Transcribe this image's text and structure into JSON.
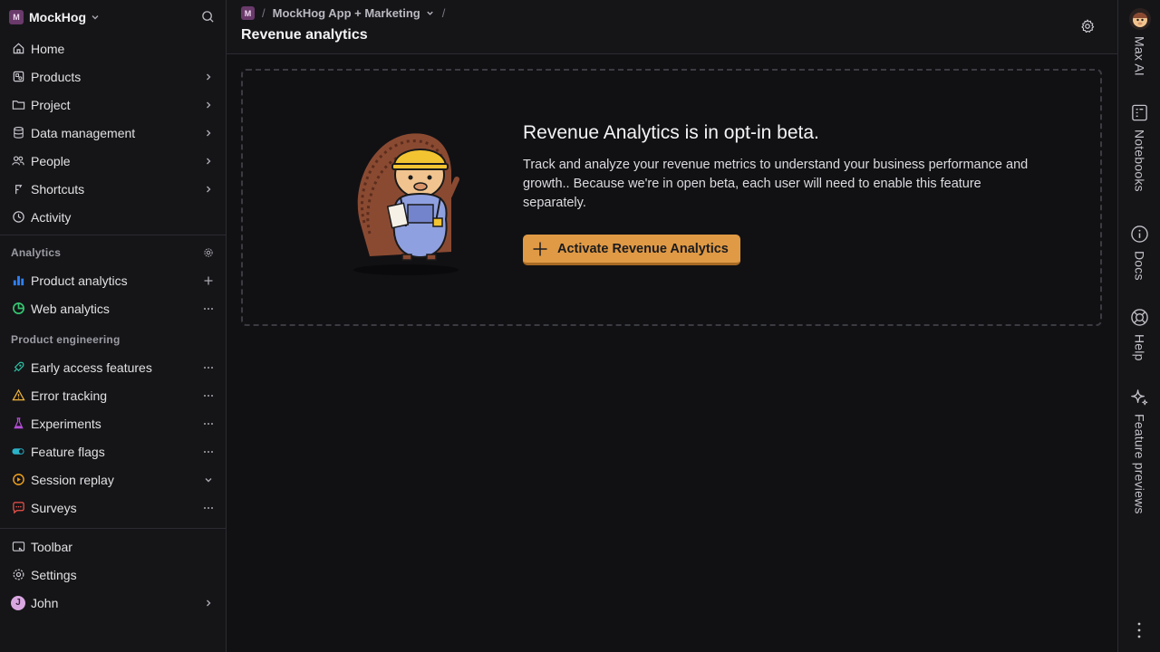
{
  "sidebar": {
    "org": {
      "badge": "M",
      "name": "MockHog"
    },
    "nav": [
      {
        "label": "Home",
        "icon": "home-icon"
      },
      {
        "label": "Products",
        "icon": "products-icon"
      },
      {
        "label": "Project",
        "icon": "folder-icon"
      },
      {
        "label": "Data management",
        "icon": "database-icon"
      },
      {
        "label": "People",
        "icon": "people-icon"
      },
      {
        "label": "Shortcuts",
        "icon": "shortcut-icon"
      },
      {
        "label": "Activity",
        "icon": "clock-icon"
      }
    ],
    "analytics_label": "Analytics",
    "analytics": [
      {
        "label": "Product analytics",
        "icon": "bar-chart-icon"
      },
      {
        "label": "Web analytics",
        "icon": "pie-icon"
      }
    ],
    "engineering_label": "Product engineering",
    "engineering": [
      {
        "label": "Early access features",
        "icon": "rocket-icon"
      },
      {
        "label": "Error tracking",
        "icon": "warning-icon"
      },
      {
        "label": "Experiments",
        "icon": "flask-icon"
      },
      {
        "label": "Feature flags",
        "icon": "toggle-icon"
      },
      {
        "label": "Session replay",
        "icon": "play-icon"
      },
      {
        "label": "Surveys",
        "icon": "chat-icon"
      }
    ],
    "bottom": [
      {
        "label": "Toolbar",
        "icon": "toolbar-icon"
      },
      {
        "label": "Settings",
        "icon": "gear-icon"
      },
      {
        "label": "John",
        "avatar": "J"
      }
    ]
  },
  "header": {
    "badge": "M",
    "project": "MockHog App + Marketing",
    "separator": "/",
    "title": "Revenue analytics"
  },
  "optin": {
    "title": "Revenue Analytics is in opt-in beta.",
    "description": "Track and analyze your revenue metrics to understand your business performance and growth.. Because we're in open beta, each user will need to enable this feature separately.",
    "button": "Activate Revenue Analytics"
  },
  "rail": {
    "items": [
      {
        "label": "Max AI"
      },
      {
        "label": "Notebooks"
      },
      {
        "label": "Docs"
      },
      {
        "label": "Help"
      },
      {
        "label": "Feature previews"
      }
    ]
  },
  "colors": {
    "accent": "#e09a45",
    "background": "#111114",
    "sidebar": "#151518"
  }
}
